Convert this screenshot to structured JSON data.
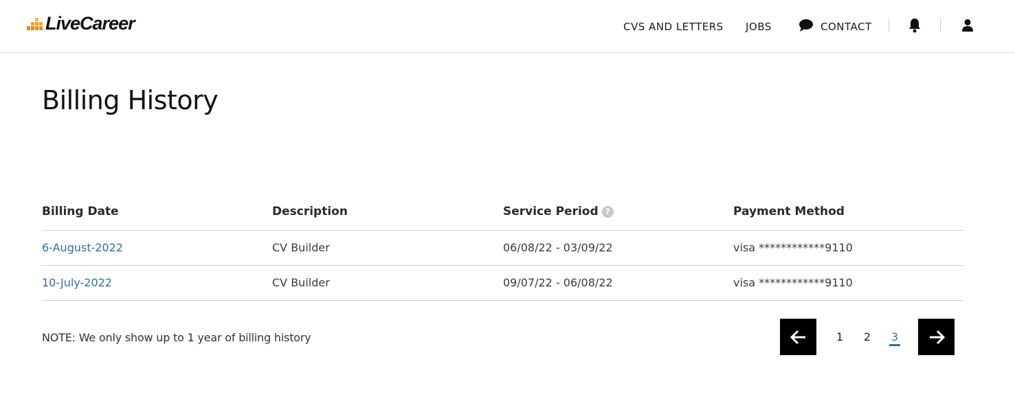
{
  "header": {
    "logo_text": "LiveCareer",
    "nav": {
      "cvs_letters": "CVS AND LETTERS",
      "jobs": "JOBS",
      "contact": "CONTACT"
    },
    "icons": {
      "contact": "chat-bubble-icon",
      "notifications": "bell-icon",
      "account": "user-icon"
    }
  },
  "page": {
    "title": "Billing History"
  },
  "table": {
    "columns": {
      "billing_date": "Billing Date",
      "description": "Description",
      "service_period": "Service Period",
      "payment_method": "Payment Method"
    },
    "service_period_help": "?",
    "rows": [
      {
        "billing_date": "6-August-2022",
        "description": "CV Builder",
        "service_period": "06/08/22 - 03/09/22",
        "payment_method": "visa ************9110"
      },
      {
        "billing_date": "10-July-2022",
        "description": "CV Builder",
        "service_period": "09/07/22 - 06/08/22",
        "payment_method": "visa ************9110"
      }
    ]
  },
  "note": "NOTE: We only show up to 1 year of billing history",
  "pagination": {
    "pages": [
      "1",
      "2",
      "3"
    ],
    "current_page": "3",
    "icons": {
      "prev": "arrow-left-icon",
      "next": "arrow-right-icon"
    }
  },
  "colors": {
    "link": "#2f6fa7",
    "logo_orange": "#e88a1a",
    "pager_bg": "#000000",
    "divider": "#d0d0d0"
  }
}
